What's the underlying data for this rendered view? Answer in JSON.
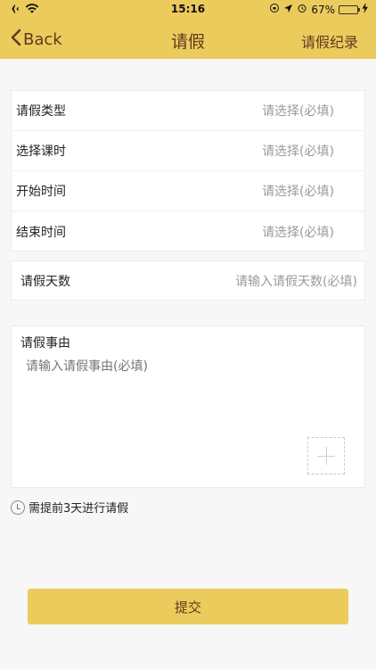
{
  "status_bar": {
    "time": "15:16",
    "battery_percent": "67%",
    "battery_level": 0.67
  },
  "nav": {
    "back_label": "Back",
    "title": "请假",
    "right_label": "请假纪录"
  },
  "form": {
    "rows": [
      {
        "label": "请假类型",
        "placeholder": "请选择(必填)"
      },
      {
        "label": "选择课时",
        "placeholder": "请选择(必填)"
      },
      {
        "label": "开始时间",
        "placeholder": "请选择(必填)"
      },
      {
        "label": "结束时间",
        "placeholder": "请选择(必填)"
      }
    ],
    "days": {
      "label": "请假天数",
      "placeholder": "请输入请假天数(必填)"
    },
    "reason": {
      "label": "请假事由",
      "placeholder": "请输入请假事由(必填)"
    }
  },
  "notice": "需提前3天进行请假",
  "submit_label": "提交",
  "colors": {
    "accent": "#eccb5d",
    "nav_text": "#5b3b1e"
  }
}
